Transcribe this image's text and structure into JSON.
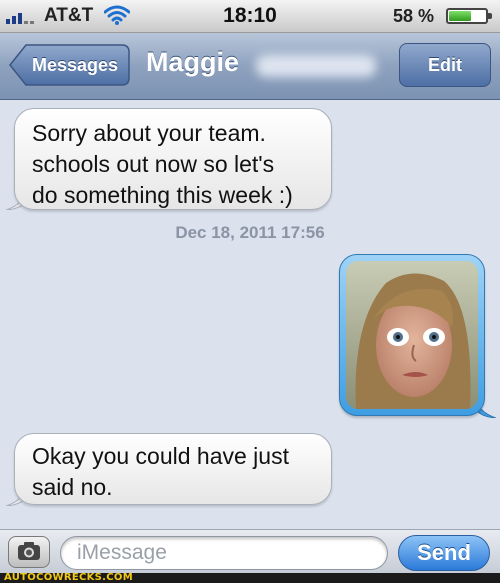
{
  "status_bar": {
    "carrier": "AT&T",
    "time": "18:10",
    "battery_percent": "58 %",
    "battery_level": 0.58
  },
  "nav": {
    "back_label": "Messages",
    "title": "Maggie",
    "edit_label": "Edit"
  },
  "messages": [
    {
      "direction": "incoming",
      "text": "Sorry about your team.\nschools out now so let's\ndo something this week :)"
    },
    {
      "direction": "outgoing",
      "type": "photo",
      "icon": "portrait-photo"
    },
    {
      "direction": "incoming",
      "text": "Okay you could have just\nsaid no."
    }
  ],
  "timestamp": "Dec 18, 2011 17:56",
  "input_bar": {
    "placeholder": "iMessage",
    "send_label": "Send",
    "camera_icon": "camera-icon"
  },
  "footer": {
    "watermark": "AUTOCOWRECKS.COM"
  },
  "colors": {
    "nav": "#8ea2bf",
    "background": "#dbe2ed",
    "outgoing_bubble": "#3e9de2",
    "send_button": "#2b7ad9"
  }
}
